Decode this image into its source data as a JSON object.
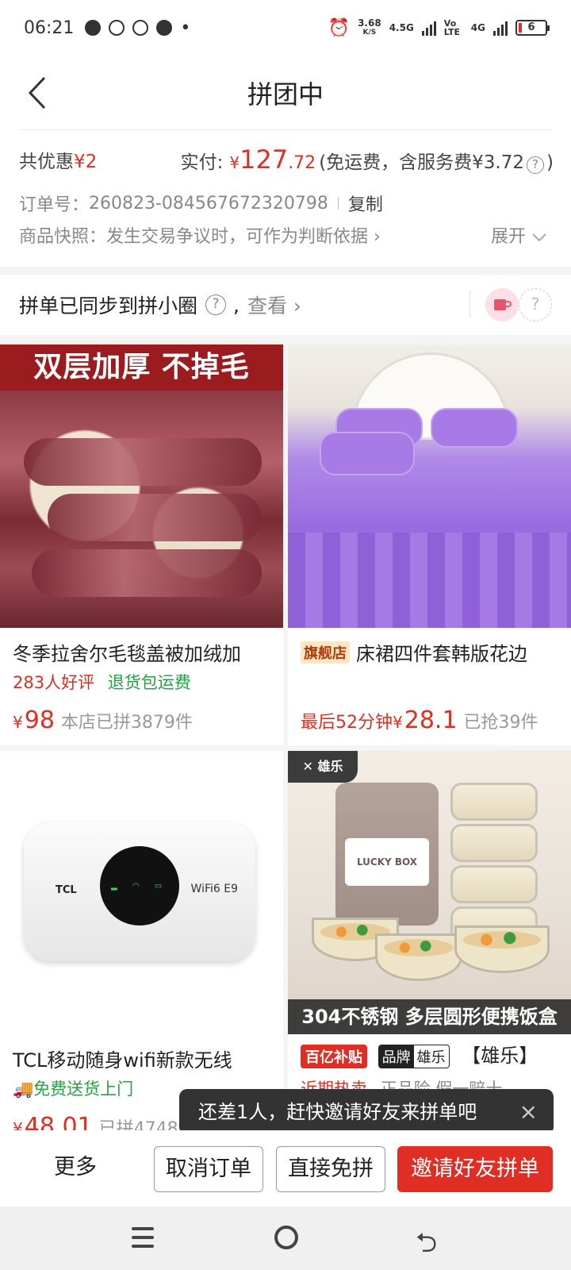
{
  "status": {
    "time": "06:21",
    "net_speed": "3.68",
    "net_unit": "K/S",
    "net_45g": "4.5G",
    "volte": "Vo LTE",
    "net_4g": "4G",
    "battery": "6"
  },
  "nav": {
    "title": "拼团中"
  },
  "order": {
    "discount_label": "共优惠",
    "discount_value": "¥2",
    "paid_label": "实付:",
    "paid_currency": "¥",
    "paid_int": "127",
    "paid_dec": ".72",
    "paid_note_pre": "(免运费，含服务费¥3.72",
    "paid_note_post": ")",
    "order_no_label": "订单号：",
    "order_no": "260823-084567672320798",
    "copy": "复制",
    "snapshot": "商品快照：发生交易争议时，可作为判断依据 ›",
    "expand": "展开"
  },
  "sync": {
    "text": "拼单已同步到拼小圈",
    "comma": ",",
    "view": "查看 ›"
  },
  "products": [
    {
      "banner": "双层加厚 不掉毛",
      "title": "冬季拉舍尔毛毯盖被加绒加",
      "tag1": "283人好评",
      "tag2": "退货包运费",
      "currency": "¥",
      "price": "98",
      "sold": "本店已拼3879件"
    },
    {
      "badge": "旗舰店",
      "title": "床裙四件套韩版花边",
      "countdown": "最后52分钟",
      "currency": "¥",
      "price": "28.1",
      "sold": "已抢39件"
    },
    {
      "img_brand": "TCL",
      "img_model": "WiFi6 E9",
      "title": "TCL移动随身wifi新款无线",
      "tag": "免费送货上门",
      "currency": "¥",
      "price": "48.01",
      "sold": "已拼4748件"
    },
    {
      "img_badge": "雄乐",
      "img_label": "LUCKY BOX",
      "caption": "304不锈钢 多层圆形便携饭盒",
      "badge_baiyi": "百亿补贴",
      "badge_brand_1": "品牌",
      "badge_brand_2": "雄乐",
      "title": "【雄乐】",
      "tag1": "近期热卖",
      "tag2": "正品险 假一赔十"
    }
  ],
  "tooltip": {
    "text": "还差1人，赶快邀请好友来拼单吧",
    "close": "×"
  },
  "actions": {
    "more": "更多",
    "cancel": "取消订单",
    "direct": "直接免拼",
    "invite": "邀请好友拼单"
  },
  "colors": {
    "accent": "#e02e24",
    "green": "#25a244"
  }
}
